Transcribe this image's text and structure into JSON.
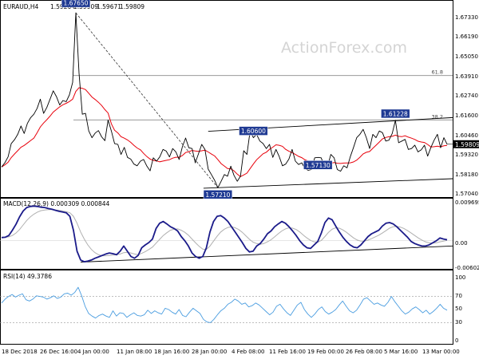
{
  "colors": {
    "price": "#000000",
    "ma": "#e8000b",
    "macd": "#1b1b8a",
    "signal": "#b0b0b0",
    "rsi": "#4a9de0",
    "flag_bg": "#1f3a93",
    "trendline": "#000000",
    "retrace": "#8a8a8a"
  },
  "watermark": "ActionForex.com",
  "chart_data": [
    {
      "type": "line",
      "panel": "price",
      "title": "EURAUD,H4",
      "ohlc": [
        "1.59264",
        "1.59909",
        "1.59671",
        "1.59809"
      ],
      "ylim": [
        1.5675,
        1.678
      ],
      "y_ticks": [
        "1.67330",
        "1.66190",
        "1.65050",
        "1.63910",
        "1.62740",
        "1.61600",
        "1.60460",
        "1.59320",
        "1.58180",
        "1.57040"
      ],
      "x_ticks": [
        "18 Dec 2018",
        "26 Dec 16:00",
        "4 Jan 00:00",
        "11 Jan 08:00",
        "18 Jan 16:00",
        "28 Jan 00:00",
        "4 Feb 08:00",
        "11 Feb 16:00",
        "19 Feb 00:00",
        "26 Feb 08:00",
        "5 Mar 16:00",
        "13 Mar 00:00"
      ],
      "last_price": "1.59809",
      "fib_levels": [
        {
          "label": "61.8",
          "value": 1.6391
        },
        {
          "label": "38.2",
          "value": 1.6126
        }
      ],
      "point_labels": [
        "1.67650",
        "1.60600",
        "1.61228",
        "1.57210",
        "1.57130"
      ],
      "series": [
        {
          "x": [
            0,
            4,
            8,
            12,
            16,
            20,
            24,
            28,
            32,
            36,
            40,
            44,
            48,
            52,
            56,
            60,
            64,
            68,
            72,
            76,
            80,
            84,
            88,
            92,
            96,
            100,
            104,
            108,
            112,
            116,
            120,
            124,
            128,
            132,
            136,
            140,
            144,
            148,
            152,
            156,
            160,
            164,
            168,
            172,
            176,
            180,
            184,
            188,
            192,
            196,
            200,
            204,
            208,
            212,
            216,
            220,
            224,
            228,
            232,
            236,
            240,
            244,
            248,
            252,
            256,
            260,
            264,
            268,
            272,
            276,
            280,
            284,
            288,
            292,
            296,
            300,
            304,
            308,
            312,
            316,
            320,
            324,
            328,
            332,
            336,
            340,
            344,
            348,
            352,
            356,
            360,
            364,
            368,
            372,
            376,
            380,
            384,
            388,
            392,
            396,
            400,
            404,
            408,
            412,
            416,
            420,
            424,
            428,
            432,
            436,
            440,
            444,
            448,
            452,
            456,
            460,
            464,
            468,
            472,
            476,
            480,
            484,
            488,
            492,
            496,
            500,
            504,
            508,
            512,
            516,
            520,
            524,
            528,
            532,
            536,
            540,
            544,
            548,
            552
          ],
          "values": [
            1.5845,
            1.587,
            1.5905,
            1.5985,
            1.6008,
            1.604,
            1.609,
            1.6045,
            1.6105,
            1.614,
            1.616,
            1.6195,
            1.625,
            1.6165,
            1.62,
            1.625,
            1.63,
            1.6265,
            1.6215,
            1.6242,
            1.6235,
            1.6275,
            1.635,
            1.6765,
            1.6405,
            1.616,
            1.6165,
            1.606,
            1.602,
            1.6048,
            1.6062,
            1.6025,
            1.6002,
            1.6125,
            1.606,
            1.5985,
            1.598,
            1.592,
            1.5962,
            1.5902,
            1.5892,
            1.5862,
            1.5852,
            1.588,
            1.589,
            1.585,
            1.5822,
            1.59,
            1.588,
            1.5905,
            1.595,
            1.594,
            1.5905,
            1.5955,
            1.5935,
            1.589,
            1.5965,
            1.6018,
            1.596,
            1.5955,
            1.587,
            1.5925,
            1.598,
            1.595,
            1.5832,
            1.58,
            1.5765,
            1.5721,
            1.576,
            1.58,
            1.579,
            1.585,
            1.5795,
            1.576,
            1.579,
            1.5942,
            1.592,
            1.606,
            1.602,
            1.604,
            1.6,
            1.5985,
            1.5955,
            1.598,
            1.5902,
            1.595,
            1.5908,
            1.5852,
            1.5862,
            1.5892,
            1.595,
            1.588,
            1.586,
            1.587,
            1.5835,
            1.5825,
            1.583,
            1.59,
            1.5902,
            1.59,
            1.585,
            1.585,
            1.592,
            1.59,
            1.583,
            1.582,
            1.5852,
            1.584,
            1.5905,
            1.596,
            1.602,
            1.604,
            1.607,
            1.602,
            1.5955,
            1.604,
            1.602,
            1.606,
            1.605,
            1.6,
            1.6005,
            1.6045,
            1.6123,
            1.599,
            1.6,
            1.601,
            1.595,
            1.5955,
            1.5975,
            1.5935,
            1.5948,
            1.5975,
            1.591,
            1.5962,
            1.6005,
            1.604,
            1.596,
            1.602,
            1.5981
          ]
        }
      ]
    },
    {
      "type": "line",
      "panel": "macd",
      "title": "MACD(12,26,9) 0.000309 0.000844",
      "ylim": [
        -0.0078,
        0.0118
      ],
      "y_ticks": [
        "0.009695",
        "0.00",
        "-0.006025"
      ],
      "series": [
        {
          "name": "MACD",
          "values": [
            0.0009,
            0.001,
            0.0015,
            0.003,
            0.0047,
            0.0068,
            0.0085,
            0.0095,
            0.0098,
            0.0099,
            0.0098,
            0.0096,
            0.0095,
            0.0092,
            0.009,
            0.0087,
            0.0084,
            0.0082,
            0.008,
            0.007,
            0.003,
            -0.003,
            -0.0055,
            -0.006,
            -0.0058,
            -0.0055,
            -0.005,
            -0.0046,
            -0.0042,
            -0.0038,
            -0.0035,
            -0.0037,
            -0.004,
            -0.003,
            -0.0015,
            -0.003,
            -0.0045,
            -0.005,
            -0.0042,
            -0.002,
            -0.0012,
            -0.0005,
            0.0005,
            0.0035,
            0.005,
            0.0055,
            0.0048,
            0.004,
            0.0035,
            0.0028,
            0.0012,
            0.0,
            -0.0015,
            -0.0035,
            -0.0045,
            -0.005,
            -0.0045,
            -0.002,
            0.0025,
            0.0055,
            0.007,
            0.0072,
            0.0065,
            0.0055,
            0.004,
            0.0025,
            0.001,
            -0.0005,
            -0.0022,
            -0.0032,
            -0.003,
            -0.0015,
            -0.0008,
            0.0005,
            0.002,
            0.0028,
            0.004,
            0.0048,
            0.0055,
            0.005,
            0.004,
            0.0028,
            0.0015,
            0.0,
            -0.0012,
            -0.002,
            -0.0022,
            -0.0012,
            -0.0002,
            0.0022,
            0.0052,
            0.0065,
            0.006,
            0.0042,
            0.0025,
            0.001,
            -0.0002,
            -0.0012,
            -0.0018,
            -0.002,
            -0.0012,
            0.0,
            0.0012,
            0.002,
            0.0025,
            0.003,
            0.0042,
            0.005,
            0.0052,
            0.0048,
            0.004,
            0.003,
            0.002,
            0.001,
            -0.0002,
            -0.0008,
            -0.0012,
            -0.0015,
            -0.0015,
            -0.0012,
            -0.0006,
            0.0,
            0.0008,
            0.0005,
            0.0003
          ]
        },
        {
          "name": "Signal",
          "values": [
            0.001,
            0.001,
            0.0011,
            0.0015,
            0.0022,
            0.0032,
            0.0045,
            0.0058,
            0.0068,
            0.0076,
            0.0082,
            0.0086,
            0.0088,
            0.0089,
            0.0089,
            0.0088,
            0.0087,
            0.0085,
            0.0083,
            0.008,
            0.007,
            0.005,
            0.0025,
            0.0005,
            -0.0012,
            -0.0025,
            -0.0034,
            -0.004,
            -0.0043,
            -0.0043,
            -0.0042,
            -0.0041,
            -0.004,
            -0.0038,
            -0.0034,
            -0.0033,
            -0.0035,
            -0.0038,
            -0.004,
            -0.0036,
            -0.0031,
            -0.0025,
            -0.0018,
            -0.0007,
            0.0004,
            0.0015,
            0.0023,
            0.003,
            0.0033,
            0.0034,
            0.003,
            0.0024,
            0.0016,
            0.0005,
            -0.0006,
            -0.0016,
            -0.0024,
            -0.0025,
            -0.0015,
            -0.0001,
            0.0013,
            0.0025,
            0.0033,
            0.0038,
            0.004,
            0.0037,
            0.0032,
            0.0024,
            0.0014,
            0.0004,
            -0.0004,
            -0.0008,
            -0.001,
            -0.0008,
            -0.0003,
            0.0003,
            0.0011,
            0.002,
            0.0028,
            0.0034,
            0.0037,
            0.0036,
            0.0032,
            0.0025,
            0.0016,
            0.0008,
            0.0001,
            -0.0003,
            -0.0004,
            0.0001,
            0.0012,
            0.0024,
            0.0033,
            0.0037,
            0.0036,
            0.0031,
            0.0024,
            0.0016,
            0.0008,
            0.0002,
            -0.0001,
            -0.0001,
            0.0002,
            0.0006,
            0.0011,
            0.0016,
            0.0022,
            0.0029,
            0.0036,
            0.004,
            0.0041,
            0.0039,
            0.0035,
            0.0029,
            0.0022,
            0.0015,
            0.0008,
            0.0002,
            -0.0003,
            -0.0006,
            -0.0007,
            -0.0006,
            -0.0003,
            -0.0001,
            0.0001
          ]
        }
      ]
    },
    {
      "type": "line",
      "panel": "rsi",
      "title": "RSI(14) 49.3786",
      "ylim": [
        0,
        100
      ],
      "y_ticks": [
        "100",
        "70",
        "50",
        "30",
        "0"
      ],
      "series": [
        {
          "name": "RSI",
          "values": [
            60,
            66,
            70,
            73,
            69,
            72,
            74,
            65,
            63,
            66,
            71,
            70,
            69,
            66,
            68,
            71,
            67,
            69,
            74,
            75,
            72,
            76,
            84,
            71,
            55,
            44,
            40,
            37,
            41,
            43,
            40,
            38,
            48,
            40,
            45,
            44,
            38,
            42,
            45,
            41,
            40,
            42,
            49,
            44,
            48,
            45,
            43,
            52,
            50,
            46,
            43,
            50,
            41,
            39,
            46,
            52,
            48,
            44,
            35,
            31,
            30,
            35,
            42,
            48,
            52,
            58,
            61,
            66,
            63,
            58,
            60,
            54,
            56,
            60,
            57,
            52,
            47,
            42,
            46,
            55,
            58,
            51,
            45,
            41,
            49,
            57,
            61,
            50,
            43,
            38,
            43,
            50,
            54,
            47,
            43,
            46,
            50,
            57,
            63,
            55,
            48,
            45,
            49,
            57,
            66,
            68,
            63,
            58,
            60,
            57,
            55,
            61,
            70,
            62,
            55,
            48,
            43,
            46,
            51,
            54,
            50,
            45,
            49,
            43,
            47,
            52,
            58,
            52,
            49
          ]
        }
      ]
    }
  ]
}
